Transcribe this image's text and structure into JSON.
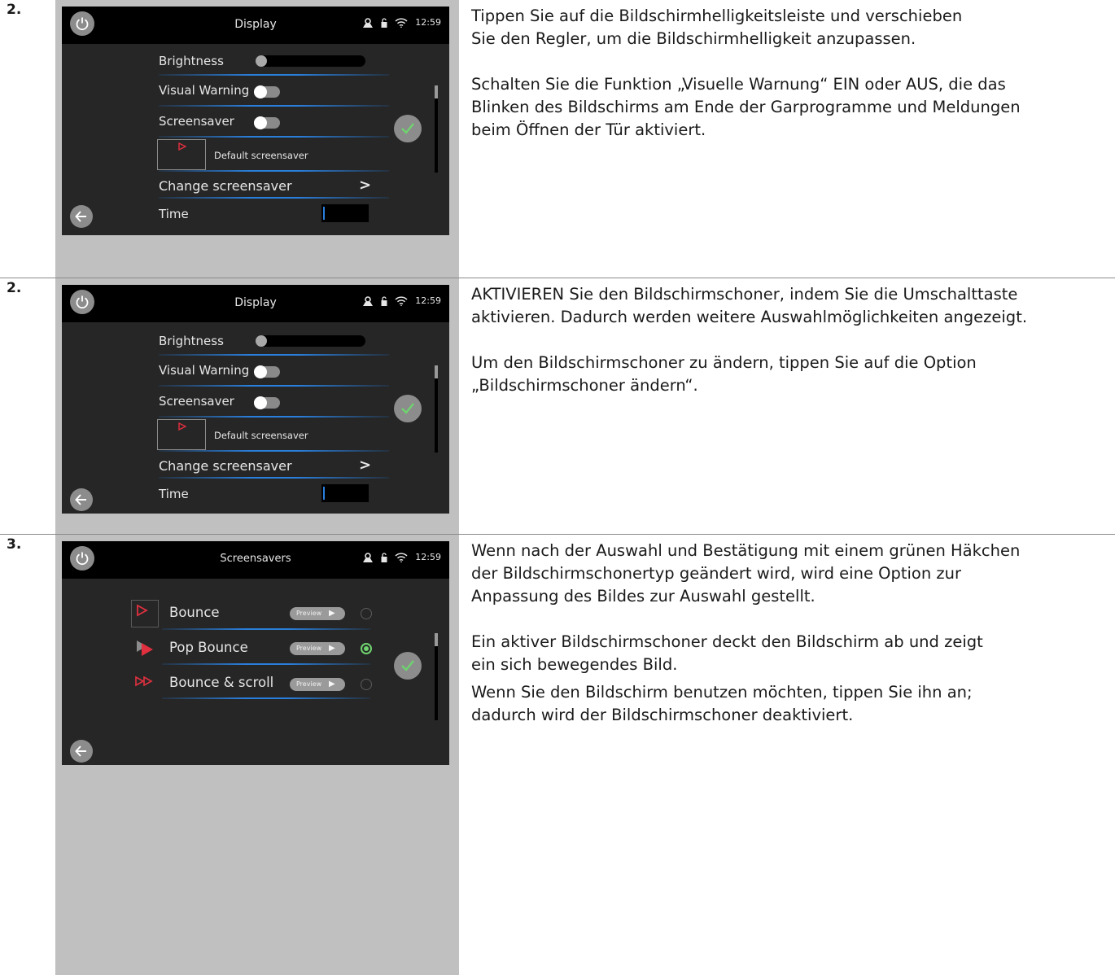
{
  "colors": {
    "accent_blue": "#2a7fdc",
    "check_green": "#6fd36f",
    "screen_bg": "#262626",
    "panel_gray": "#c0c0c0"
  },
  "status": {
    "time": "12:59",
    "icons": [
      "user-icon",
      "lock-icon",
      "wifi-icon"
    ]
  },
  "steps": [
    {
      "number": "2.",
      "screen_title": "Display",
      "brightness_label": "Brightness",
      "visual_warning_label": "Visual Warning",
      "screensaver_label": "Screensaver",
      "default_screensaver_label": "Default screensaver",
      "change_screensaver_label": "Change screensaver",
      "time_label": "Time",
      "text1": "Tippen Sie auf die Bildschirmhelligkeitsleiste und verschieben\nSie den Regler, um die Bildschirmhelligkeit anzupassen.",
      "text2": "Schalten Sie die Funktion „Visuelle Warnung“ EIN oder AUS, die das\nBlinken des Bildschirms am Ende der Garprogramme und Meldungen\nbeim Öffnen der Tür aktiviert."
    },
    {
      "number": "2.",
      "screen_title": "Display",
      "brightness_label": "Brightness",
      "visual_warning_label": "Visual Warning",
      "screensaver_label": "Screensaver",
      "default_screensaver_label": "Default screensaver",
      "change_screensaver_label": "Change screensaver",
      "time_label": "Time",
      "text1": "AKTIVIEREN Sie den Bildschirmschoner, indem Sie die Umschalttaste\naktivieren. Dadurch werden weitere Auswahlmöglichkeiten angezeigt.",
      "text2": "Um den Bildschirmschoner zu ändern, tippen Sie auf die Option\n„Bildschirmschoner ändern“."
    },
    {
      "number": "3.",
      "screen_title": "Screensavers",
      "options": [
        {
          "label": "Bounce",
          "preview": "Preview",
          "selected": false
        },
        {
          "label": "Pop Bounce",
          "preview": "Preview",
          "selected": true
        },
        {
          "label": "Bounce & scroll",
          "preview": "Preview",
          "selected": false
        }
      ],
      "text1": "Wenn nach der Auswahl und Bestätigung mit einem grünen Häkchen\nder Bildschirmschonertyp geändert wird, wird eine Option zur\nAnpassung des Bildes zur Auswahl gestellt.",
      "text2": "Ein aktiver Bildschirmschoner deckt den Bildschirm ab und zeigt\nein sich bewegendes Bild.",
      "text3": "Wenn Sie den Bildschirm benutzen möchten, tippen Sie ihn an;\ndadurch wird der Bildschirmschoner deaktiviert."
    }
  ]
}
